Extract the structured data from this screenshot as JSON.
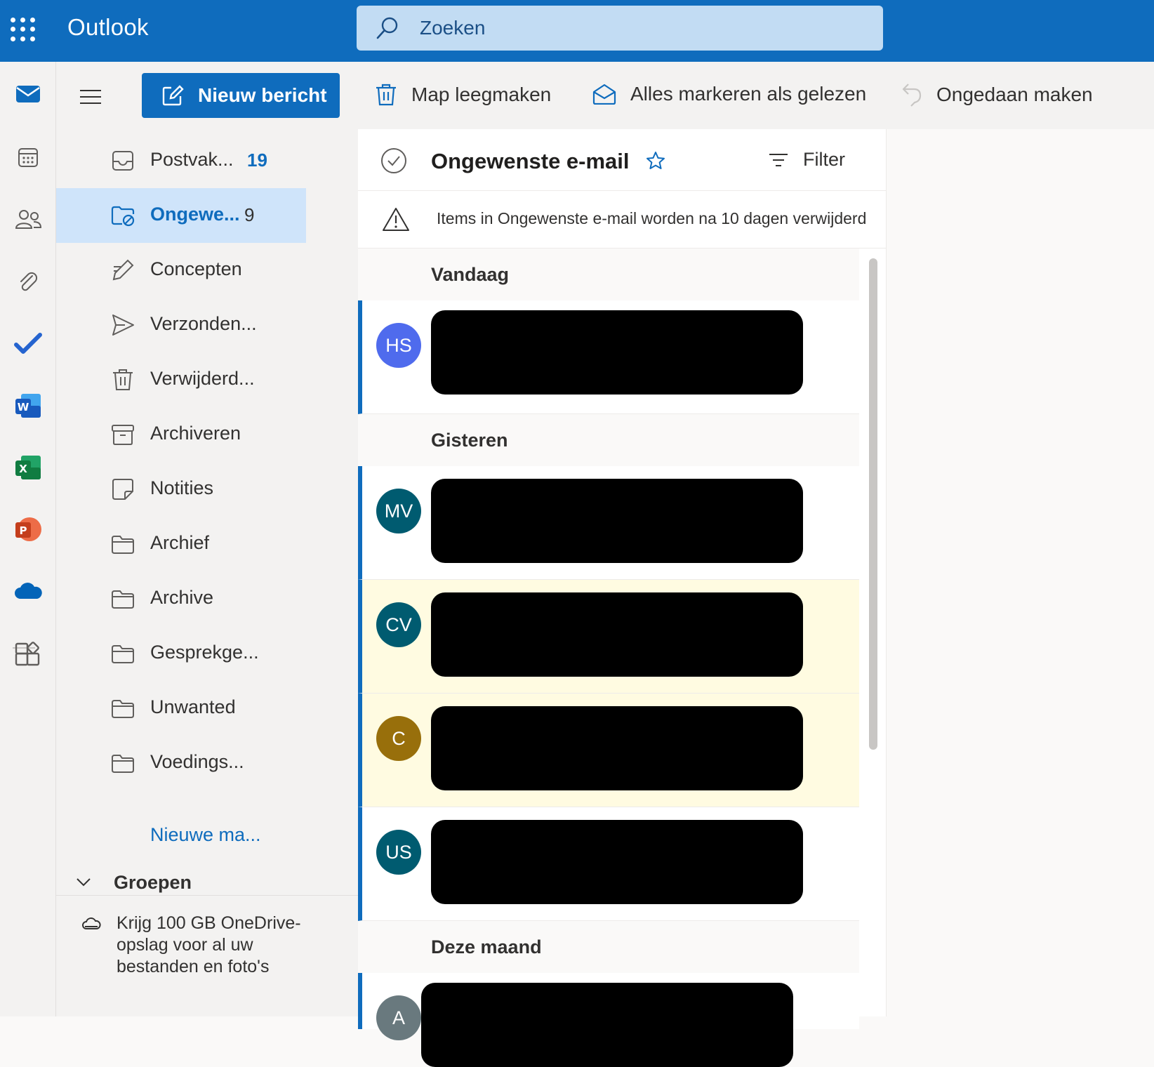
{
  "app": {
    "title": "Outlook",
    "search_placeholder": "Zoeken",
    "accent": "#0f6cbd"
  },
  "rail": {
    "icons": [
      "mail-icon",
      "calendar-icon",
      "people-icon",
      "attachment-icon",
      "todo-icon",
      "word-icon",
      "excel-icon",
      "powerpoint-icon",
      "onedrive-icon",
      "apps-icon"
    ],
    "word_letter": "W",
    "excel_letter": "X",
    "powerpoint_letter": "P"
  },
  "toolbar": {
    "new_message": "Nieuw bericht",
    "empty_folder": "Map leegmaken",
    "mark_all_read": "Alles markeren als gelezen",
    "undo": "Ongedaan maken"
  },
  "folders": [
    {
      "label": "Postvak...",
      "count": "19",
      "icon": "inbox-icon"
    },
    {
      "label": "Ongewe...",
      "count": "9",
      "icon": "junk-icon",
      "active": true
    },
    {
      "label": "Concepten",
      "icon": "drafts-icon"
    },
    {
      "label": "Verzonden...",
      "icon": "sent-icon"
    },
    {
      "label": "Verwijderd...",
      "icon": "deleted-icon"
    },
    {
      "label": "Archiveren",
      "icon": "archive-icon"
    },
    {
      "label": "Notities",
      "icon": "notes-icon"
    },
    {
      "label": "Archief",
      "icon": "folder-icon"
    },
    {
      "label": "Archive",
      "icon": "folder-icon"
    },
    {
      "label": "Gesprekge...",
      "icon": "folder-icon"
    },
    {
      "label": "Unwanted",
      "icon": "folder-icon"
    },
    {
      "label": "Voedings...",
      "icon": "folder-icon"
    }
  ],
  "new_folder": "Nieuwe ma...",
  "groups_label": "Groepen",
  "promo": "Krijg 100 GB OneDrive-opslag voor al uw bestanden en foto's",
  "list": {
    "title": "Ongewenste e-mail",
    "filter": "Filter",
    "notice": "Items in Ongewenste e-mail worden na 10 dagen verwijderd",
    "groups": [
      "Vandaag",
      "Gisteren",
      "Deze maand"
    ],
    "messages": [
      {
        "initials": "HS",
        "color": "#4f6bed",
        "unread": false
      },
      {
        "initials": "MV",
        "color": "#005b70",
        "unread": false
      },
      {
        "initials": "CV",
        "color": "#005b70",
        "unread": true
      },
      {
        "initials": "C",
        "color": "#986f0b",
        "unread": true
      },
      {
        "initials": "US",
        "color": "#005b70",
        "unread": false
      },
      {
        "initials": "A",
        "color": "#69797e",
        "unread": false
      }
    ]
  }
}
